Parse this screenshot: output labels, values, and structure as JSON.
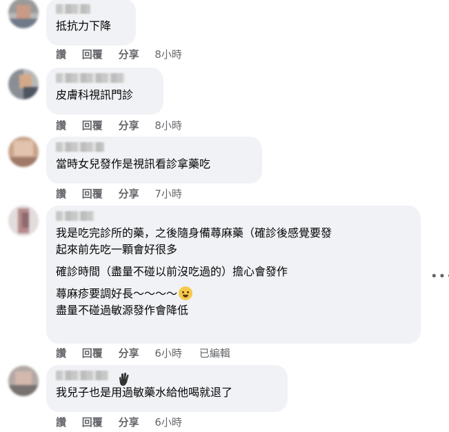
{
  "comments": [
    {
      "lines": [
        "抵抗力下降"
      ],
      "actions": {
        "like": "讚",
        "reply": "回覆",
        "share": "分享",
        "time": "8小時"
      }
    },
    {
      "lines": [
        "皮膚科視訊門診"
      ],
      "actions": {
        "like": "讚",
        "reply": "回覆",
        "share": "分享",
        "time": "8小時"
      }
    },
    {
      "lines": [
        "當時女兒發作是視訊看診拿藥吃"
      ],
      "actions": {
        "like": "讚",
        "reply": "回覆",
        "share": "分享",
        "time": "7小時"
      }
    },
    {
      "lines": [
        "我是吃完診所的藥，之後隨身備蕁麻藥（確診後感覺要發",
        "起來前先吃一顆會好很多",
        "確診時間（盡量不碰以前沒吃過的）擔心會發作",
        "蕁麻疹要調好長～～～～",
        "盡量不碰過敏源發作會降低"
      ],
      "actions": {
        "like": "讚",
        "reply": "回覆",
        "share": "分享",
        "time": "6小時",
        "edited": "已編輯"
      }
    },
    {
      "lines": [
        "我兒子也是用過敏藥水給他喝就退了"
      ],
      "actions": {
        "like": "讚",
        "reply": "回覆",
        "share": "分享",
        "time": "6小時"
      }
    }
  ],
  "icons": {
    "more": "more-options-icon",
    "emoji": "crying-face-emoji-icon",
    "wave": "waving-hand-icon"
  },
  "more_label": "•••"
}
